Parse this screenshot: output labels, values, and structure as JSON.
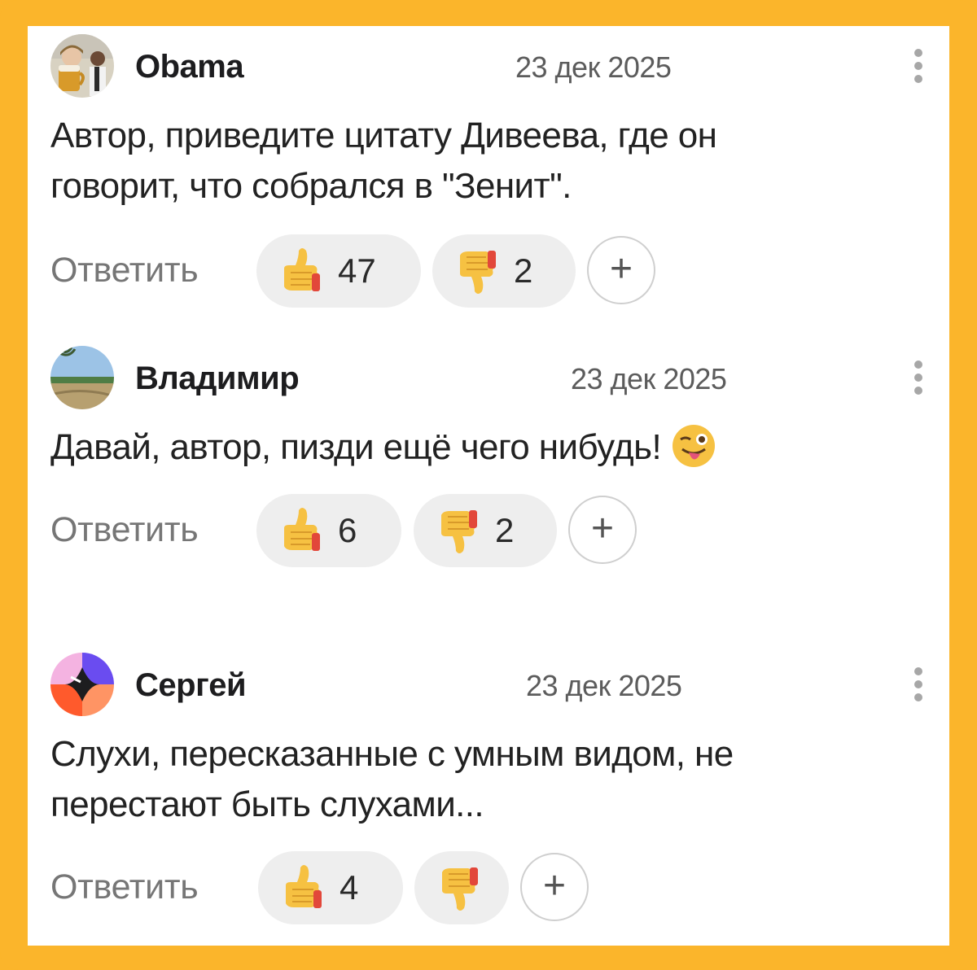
{
  "reply_label": "Ответить",
  "plus_label": "+",
  "comments": [
    {
      "author": "Obama",
      "date": "23 дек 2025",
      "text_lines": [
        "Автор, приведите цитату Дивеева, где он",
        "говорит, что собрался в \"Зенит\"."
      ],
      "likes": "47",
      "dislikes": "2"
    },
    {
      "author": "Владимир",
      "date": "23 дек 2025",
      "text_lines": [
        "Давай, автор,   пизди ещё чего нибудь!"
      ],
      "likes": "6",
      "dislikes": "2"
    },
    {
      "author": "Сергей",
      "date": "23 дек 2025",
      "text_lines": [
        "Слухи, пересказанные с умным видом, не",
        "перестают быть слухами..."
      ],
      "likes": "4",
      "dislikes": ""
    }
  ],
  "icons": {
    "thumbs_up": "thumbs-up-icon",
    "thumbs_down": "thumbs-down-icon",
    "more": "kebab-icon",
    "wink": "winking-tongue-emoji"
  },
  "colors": {
    "frame": "#fbb52b",
    "card": "#ffffff",
    "pill": "#eeeeee",
    "muted": "#767676"
  }
}
